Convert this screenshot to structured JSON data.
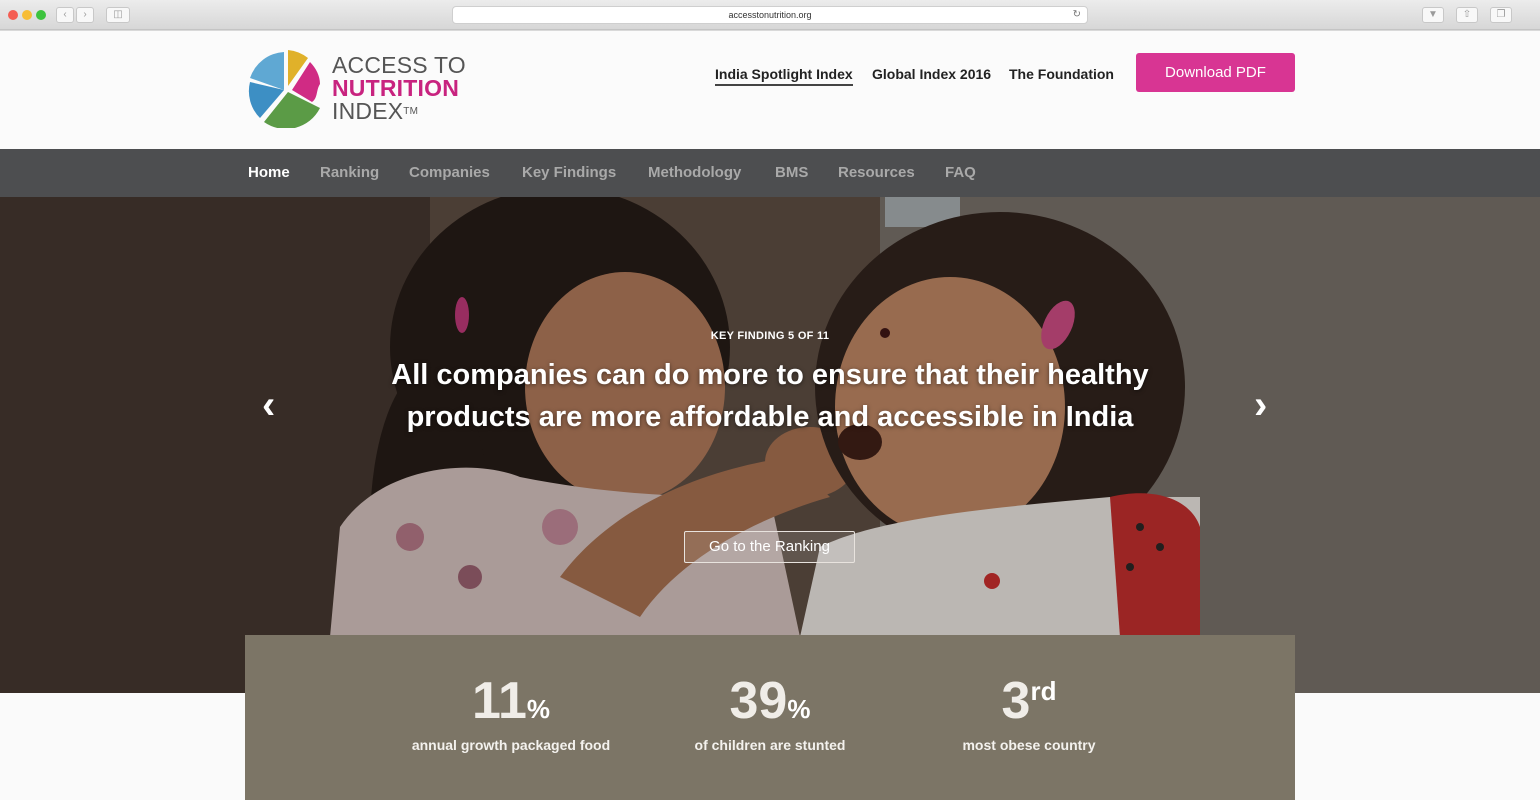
{
  "browser": {
    "url": "accesstonutrition.org"
  },
  "logo": {
    "line1": "ACCESS TO",
    "line2": "NUTRITION",
    "line3": "INDEX",
    "tm": "TM"
  },
  "topnav": {
    "items": [
      "India Spotlight Index",
      "Global Index 2016",
      "The Foundation"
    ],
    "download_label": "Download PDF"
  },
  "mainnav": {
    "items": [
      "Home",
      "Ranking",
      "Companies",
      "Key Findings",
      "Methodology",
      "BMS",
      "Resources",
      "FAQ"
    ],
    "active": "Home"
  },
  "hero": {
    "kicker": "KEY FINDING 5 OF 11",
    "headline_line1": "All companies can do more to ensure that their healthy",
    "headline_line2": "products are more affordable and accessible in India",
    "cta_label": "Go to the Ranking",
    "prev_arrow": "‹",
    "next_arrow": "›"
  },
  "stats": [
    {
      "value": "11",
      "unit": "%",
      "label": "annual growth packaged food"
    },
    {
      "value": "39",
      "unit": "%",
      "label": "of children are stunted"
    },
    {
      "value": "3",
      "unit": "rd",
      "label": "most obese country"
    }
  ],
  "colors": {
    "brand_pink": "#d83593",
    "nav_bg": "#4d4e50",
    "stats_bg": "#7c7566"
  }
}
